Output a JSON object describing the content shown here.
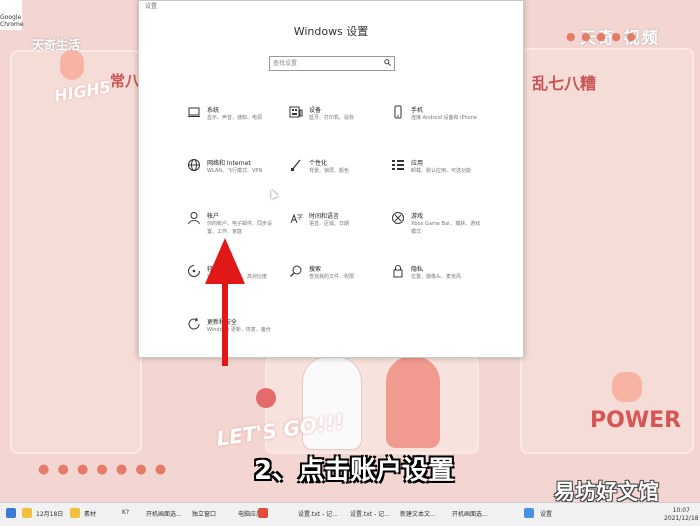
{
  "window": {
    "title": "Windows 设置",
    "search_placeholder": "查找设置"
  },
  "tiles": [
    {
      "title": "系统",
      "desc": "显示、声音、通知、电源",
      "icon": "laptop-icon"
    },
    {
      "title": "设备",
      "desc": "蓝牙、打印机、鼠标",
      "icon": "keyboard-icon"
    },
    {
      "title": "手机",
      "desc": "连接 Android 设备和 iPhone",
      "icon": "phone-icon"
    },
    {
      "title": "网络和 Internet",
      "desc": "WLAN、飞行模式、VPN",
      "icon": "globe-icon"
    },
    {
      "title": "个性化",
      "desc": "背景、锁屏、颜色",
      "icon": "paintbrush-icon"
    },
    {
      "title": "应用",
      "desc": "卸载、默认应用、可选功能",
      "icon": "apps-icon"
    },
    {
      "title": "帐户",
      "desc": "你的帐户、电子邮件、同步设置、工作、家庭",
      "icon": "person-icon"
    },
    {
      "title": "时间和语言",
      "desc": "语音、区域、日期",
      "icon": "time-language-icon"
    },
    {
      "title": "游戏",
      "desc": "Xbox Game Bar、捕获、游戏模式",
      "icon": "xbox-icon"
    },
    {
      "title": "轻松使用",
      "desc": "讲述人、放大镜、高对比度",
      "icon": "ease-of-access-icon"
    },
    {
      "title": "搜索",
      "desc": "查找我的文件、权限",
      "icon": "search-icon"
    },
    {
      "title": "隐私",
      "desc": "位置、摄像头、麦克风",
      "icon": "lock-icon"
    },
    {
      "title": "更新和安全",
      "desc": "Windows 更新、恢复、备份",
      "icon": "refresh-icon"
    }
  ],
  "caption": "2、点击账户设置",
  "watermarks": {
    "top_left": "天奇生活",
    "top_right": "天奇 视频",
    "bottom_right": "易坊好文馆"
  },
  "wallpaper": {
    "high5": "HIGH5",
    "left_text": "常八",
    "right_text": "乱七八糟",
    "power": "POWER",
    "letsgo": "LET'S GO!!!"
  },
  "taskbar": {
    "items": [
      "12月18日",
      "素材",
      "K?",
      "开机画面选...",
      "独立窗口",
      "电脑应用...",
      "设置.txt - 记...",
      "设置.txt - 记...",
      "新建文本文...",
      "开机画面选..."
    ],
    "settings_label": "设置",
    "time": "10:07",
    "date": "2021/12/18"
  },
  "desktop_icon_label": "Google Chrome",
  "colors": {
    "arrow": "#e01818",
    "wallpaper": "#f3d6d1",
    "caption_fill": "#ffffff"
  }
}
